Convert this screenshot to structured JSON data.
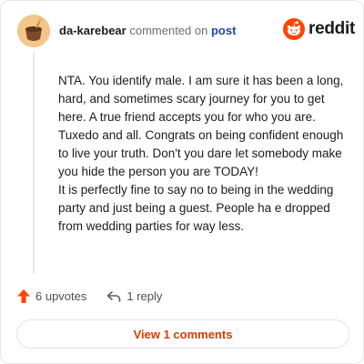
{
  "header": {
    "author": "da-karebear",
    "action_text": "commented on",
    "post_link": "post"
  },
  "brand": {
    "wordmark": "reddit",
    "icon": "reddit-logo-icon",
    "color": "#ff4500"
  },
  "comment": {
    "paragraphs": [
      "NTA. You identify male. I am sure it has been a long, hard, and sometimes scary journey for you to get here. A true friend accepts you for who you are. Tuxedo and all. Congrats on being confident enough to live your truth. Don't you dare let somebody make you hide the person you are TODAY!",
      "It is perfectly fine to say no to being in the wedding party and just being a guest. People ha e dropped from wedding parties for way less."
    ]
  },
  "actions": {
    "upvotes_label": "6 upvotes",
    "upvote_icon": "upvote-arrow-icon",
    "upvote_color": "#ff4500",
    "reply_label": "1 reply",
    "reply_icon": "reply-arrow-icon"
  },
  "footer": {
    "view_comments_label": "View 1 comments",
    "accent_color": "#d93a00"
  }
}
